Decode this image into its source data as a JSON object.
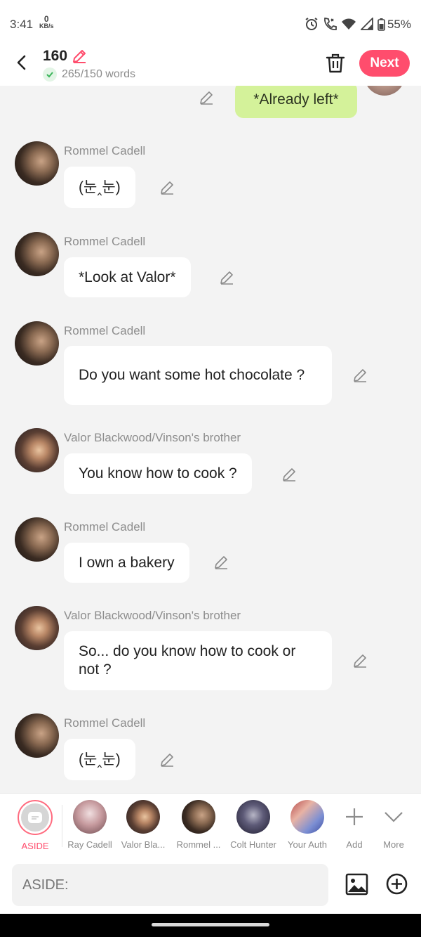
{
  "status_bar": {
    "time": "3:41",
    "speed_value": "0",
    "speed_unit": "KB/s",
    "battery": "55%"
  },
  "header": {
    "title": "160",
    "words": "265/150 words",
    "next_label": "Next"
  },
  "self_message": {
    "text": "*Already left*"
  },
  "messages": [
    {
      "sender": "Rommel Cadell",
      "text": "(눈‸눈)"
    },
    {
      "sender": "Rommel Cadell",
      "text": "*Look at Valor*"
    },
    {
      "sender": "Rommel Cadell",
      "text": "Do you want some hot chocolate ?"
    },
    {
      "sender": "Valor Blackwood/Vinson's brother",
      "text": "You know how to cook ?"
    },
    {
      "sender": "Rommel Cadell",
      "text": "I own a bakery"
    },
    {
      "sender": "Valor Blackwood/Vinson's brother",
      "text": "So... do you know how to cook or not ?"
    },
    {
      "sender": "Rommel Cadell",
      "text": "(눈‸눈)"
    }
  ],
  "characters": [
    {
      "label": "ASIDE",
      "selected": true
    },
    {
      "label": "Ray Cadell"
    },
    {
      "label": "Valor Bla..."
    },
    {
      "label": "Rommel ..."
    },
    {
      "label": "Colt Hunter"
    },
    {
      "label": "Your Auth"
    },
    {
      "label": "Add"
    },
    {
      "label": "More"
    }
  ],
  "input": {
    "placeholder": "ASIDE:"
  },
  "colors": {
    "accent": "#ff4d6d",
    "self_bubble": "#d4f29a",
    "background": "#f3f3f3"
  }
}
